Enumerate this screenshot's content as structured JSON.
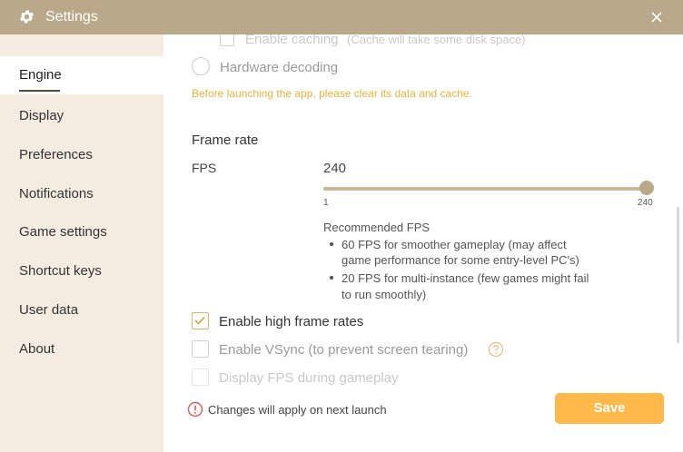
{
  "window": {
    "title": "Settings",
    "title_icon": "gear-icon",
    "close_icon": "close-icon"
  },
  "sidebar": {
    "items": [
      {
        "label": "Engine",
        "active": true
      },
      {
        "label": "Display"
      },
      {
        "label": "Preferences"
      },
      {
        "label": "Notifications"
      },
      {
        "label": "Game settings"
      },
      {
        "label": "Shortcut keys"
      },
      {
        "label": "User data"
      },
      {
        "label": "About"
      }
    ]
  },
  "engine": {
    "enable_caching_label": "Enable caching",
    "enable_caching_note": "(Cache will take some disk space)",
    "hardware_decoding_label": "Hardware decoding",
    "warning_text": "Before launching the app, please clear its data and cache.",
    "frame_rate": {
      "section_title": "Frame rate",
      "fps_label": "FPS",
      "fps_value": "240",
      "slider_min": "1",
      "slider_max": "240",
      "slider_level": 1.0,
      "recommended_title": "Recommended FPS",
      "recommendations": [
        {
          "line1": "60 FPS for smoother gameplay (may affect",
          "line2": "game performance for some entry-level PC's)"
        },
        {
          "line1": "20 FPS for multi-instance (few games might fail",
          "line2": "to run smoothly)"
        }
      ]
    },
    "enable_high_frame_rates": {
      "label": "Enable high frame rates",
      "checked": true
    },
    "enable_vsync": {
      "label": "Enable VSync (to prevent screen tearing)",
      "checked": false,
      "help_icon": "help-icon"
    },
    "display_fps": {
      "label": "Display FPS during gameplay",
      "checked": false
    }
  },
  "footer": {
    "info_icon": "info-icon",
    "notice": "Changes will apply on next launch",
    "save_label": "Save"
  },
  "colors": {
    "titlebar": "#b9a98a",
    "sidebar_bg": "#f4ece0",
    "accent": "#ffb84a",
    "warning": "#e6b43a",
    "info_red": "#e05a5a"
  }
}
